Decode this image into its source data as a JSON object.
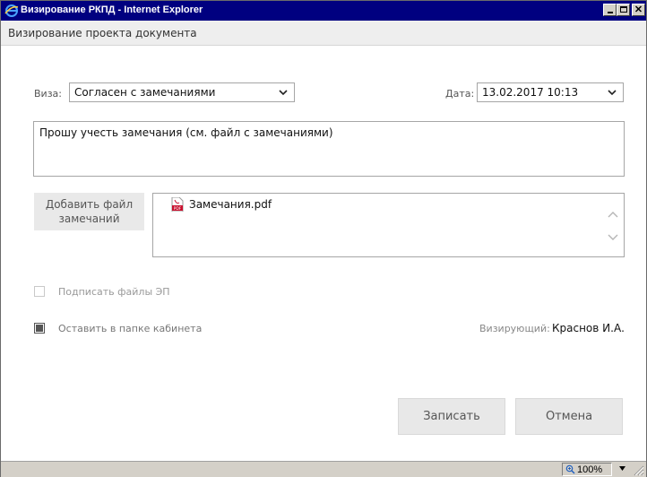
{
  "window": {
    "title": "Визирование РКПД - Internet Explorer"
  },
  "header": {
    "title": "Визирование проекта документа"
  },
  "form": {
    "visa_label": "Виза:",
    "visa_value": "Согласен с замечаниями",
    "date_label": "Дата:",
    "date_value": "13.02.2017 10:13",
    "comment": "Прошу учесть замечания (см. файл с замечаниями)",
    "add_file_button": "Добавить файл\nзамечаний",
    "files": [
      {
        "name": "Замечания.pdf",
        "icon": "pdf-icon"
      }
    ],
    "sign_files": {
      "label": "Подписать файлы ЭП",
      "checked": false,
      "enabled": false
    },
    "keep_in_folder": {
      "label": "Оставить в папке кабинета",
      "checked": true
    },
    "approver_label": "Визирующий:",
    "approver_name": "Краснов И.А."
  },
  "buttons": {
    "save": "Записать",
    "cancel": "Отмена"
  },
  "statusbar": {
    "zoom": "100%"
  },
  "colors": {
    "titlebar": "#000080",
    "button_bg": "#e8e8e8",
    "border": "#a6a6a6",
    "pdf_red": "#c8102e"
  }
}
